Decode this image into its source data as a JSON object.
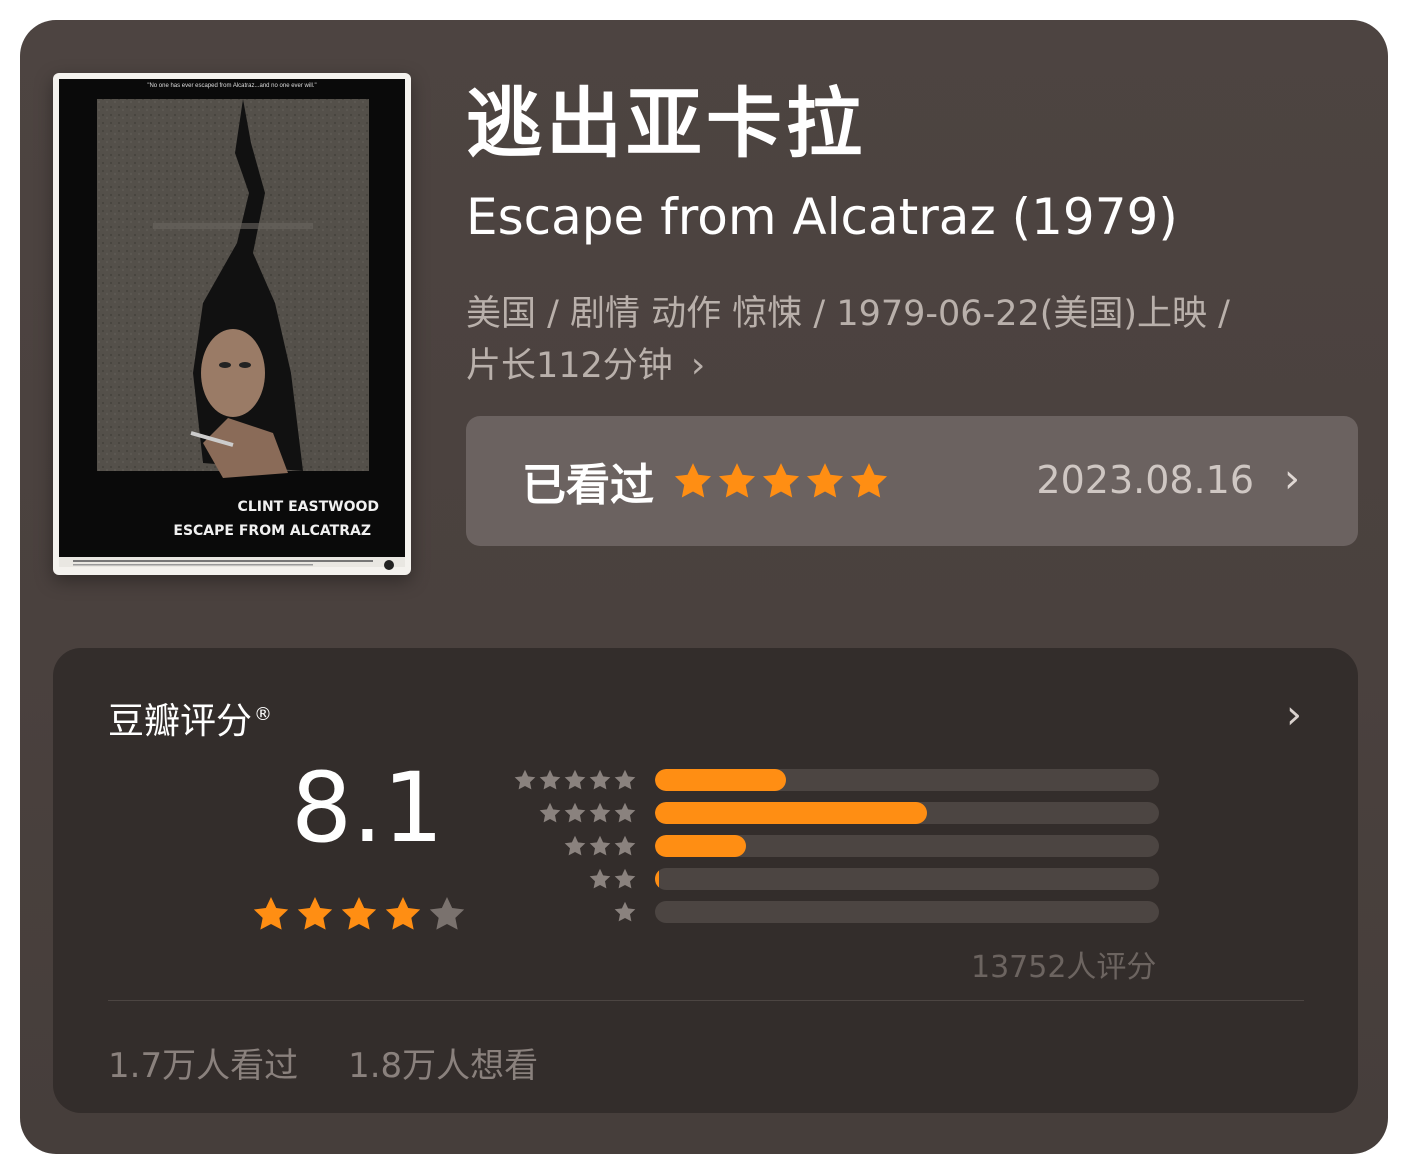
{
  "movie": {
    "title_cn": "逃出亚卡拉",
    "title_en": "Escape from Alcatraz (1979)",
    "meta_line1": "美国 / 剧情 动作 惊悚 / 1979-06-22(美国)上映 /",
    "meta_line2": "片长112分钟",
    "poster": {
      "tagline": "\"No one has ever escaped from Alcatraz...and no one ever will.\"",
      "actor": "CLINT EASTWOOD",
      "film": "ESCAPE FROM ALCATRAZ"
    }
  },
  "watched": {
    "label": "已看过",
    "user_stars": 5,
    "date": "2023.08.16",
    "chevron": "chevron-right-icon"
  },
  "rating": {
    "heading": "豆瓣评分",
    "registered_mark": "®",
    "score": "8.1",
    "score_stars": 4,
    "distribution": [
      {
        "stars": 5,
        "fraction": 0.26
      },
      {
        "stars": 4,
        "fraction": 0.54
      },
      {
        "stars": 3,
        "fraction": 0.18
      },
      {
        "stars": 2,
        "fraction": 0.01
      },
      {
        "stars": 1,
        "fraction": 0.0
      }
    ],
    "count_text": "13752人评分",
    "watched_text": "1.7万人看过",
    "want_text": "1.8万人想看"
  },
  "colors": {
    "accent": "#ff8e13",
    "star_inactive": "#7a726e",
    "card_bg": "#4a413e",
    "panel_bg": "#332d2b"
  }
}
